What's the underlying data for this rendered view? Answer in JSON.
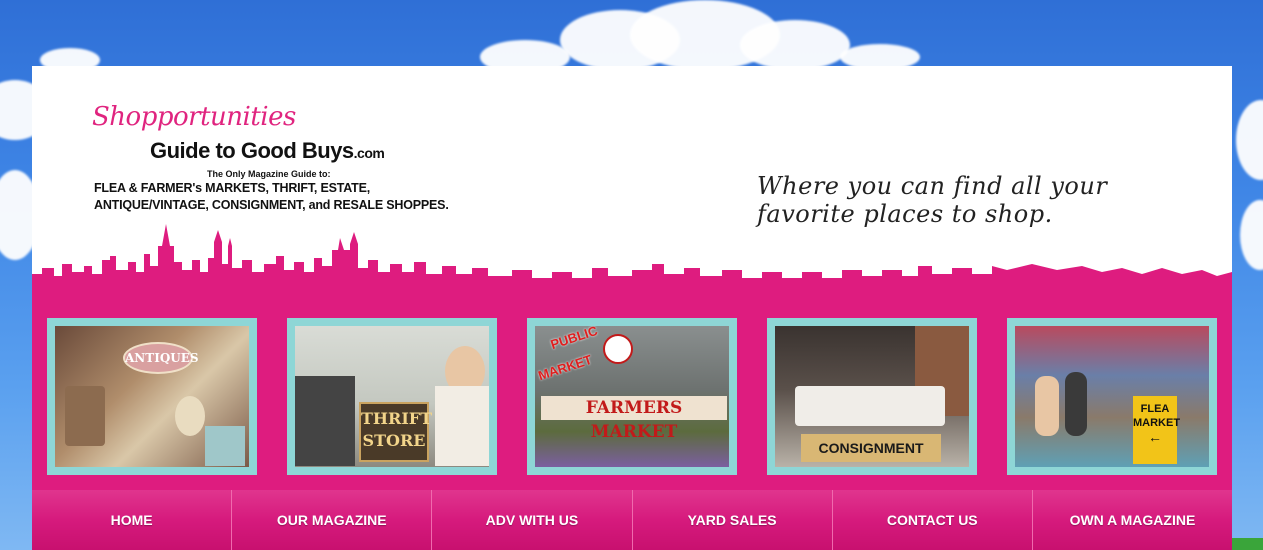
{
  "logo": {
    "script": "Shopportunities",
    "title": "Guide to Good Buys",
    "domain": ".com",
    "subtitle": "The Only Magazine Guide to:",
    "desc_line1": "FLEA & FARMER's MARKETS, THRIFT, ESTATE,",
    "desc_line2": "ANTIQUE/VINTAGE, CONSIGNMENT, and RESALE SHOPPES."
  },
  "tagline": "Where you can find all your favorite places to shop.",
  "tiles": [
    {
      "label": "ANTIQUES"
    },
    {
      "label_line1": "THRIFT",
      "label_line2": "STORE"
    },
    {
      "sign1": "PUBLIC",
      "sign2": "MARKET",
      "label": "FARMERS MARKET"
    },
    {
      "label": "CONSIGNMENT"
    },
    {
      "label_line1": "FLEA",
      "label_line2": "MARKET"
    }
  ],
  "nav": [
    {
      "label": "HOME"
    },
    {
      "label": "OUR MAGAZINE"
    },
    {
      "label": "ADV WITH US"
    },
    {
      "label": "YARD SALES"
    },
    {
      "label": "CONTACT US"
    },
    {
      "label": "OWN A MAGAZINE"
    }
  ],
  "colors": {
    "sky": "#3f86e6",
    "brand_pink": "#de1c7f",
    "tile_border": "#8ed6d6"
  }
}
